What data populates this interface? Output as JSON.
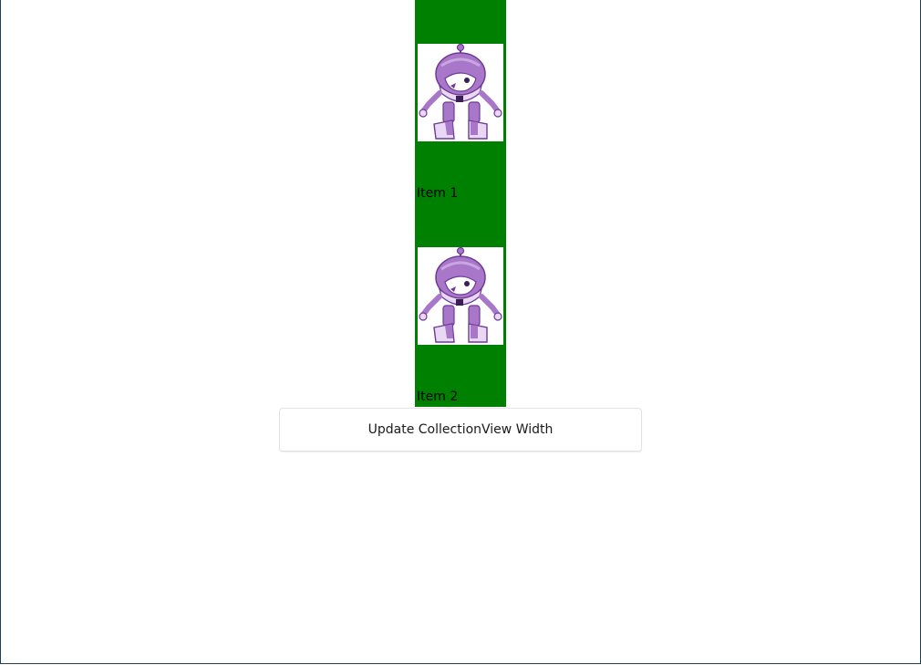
{
  "collection_view": {
    "background_color": "#008000",
    "items": [
      {
        "label": "Item 1",
        "image_icon": "dotnet-bot-icon"
      },
      {
        "label": "Item 2",
        "image_icon": "dotnet-bot-icon"
      }
    ]
  },
  "update_button": {
    "label": "Update CollectionView Width"
  },
  "colors": {
    "bot_purple": "#a877c9",
    "bot_dark": "#6e3a96",
    "bot_light": "#e9d8f3"
  }
}
